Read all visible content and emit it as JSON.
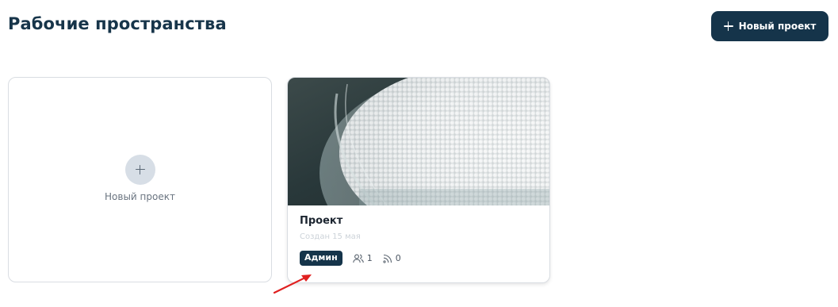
{
  "header": {
    "title": "Рабочие пространства",
    "new_project_button": "Новый проект",
    "button_icon": "plus-icon"
  },
  "new_card": {
    "label": "Новый проект",
    "icon": "plus-icon"
  },
  "project_card": {
    "title": "Проект",
    "created": "Создан 15 мая",
    "role": "Админ",
    "members_count": "1",
    "members_icon": "users-icon",
    "feeds_count": "0",
    "feeds_icon": "rss-icon",
    "image": "photo of white granules in a glass jar"
  },
  "colors": {
    "primary": "#15344a",
    "title": "#17354a",
    "border": "#d9dde2",
    "annotation": "#e02020"
  }
}
